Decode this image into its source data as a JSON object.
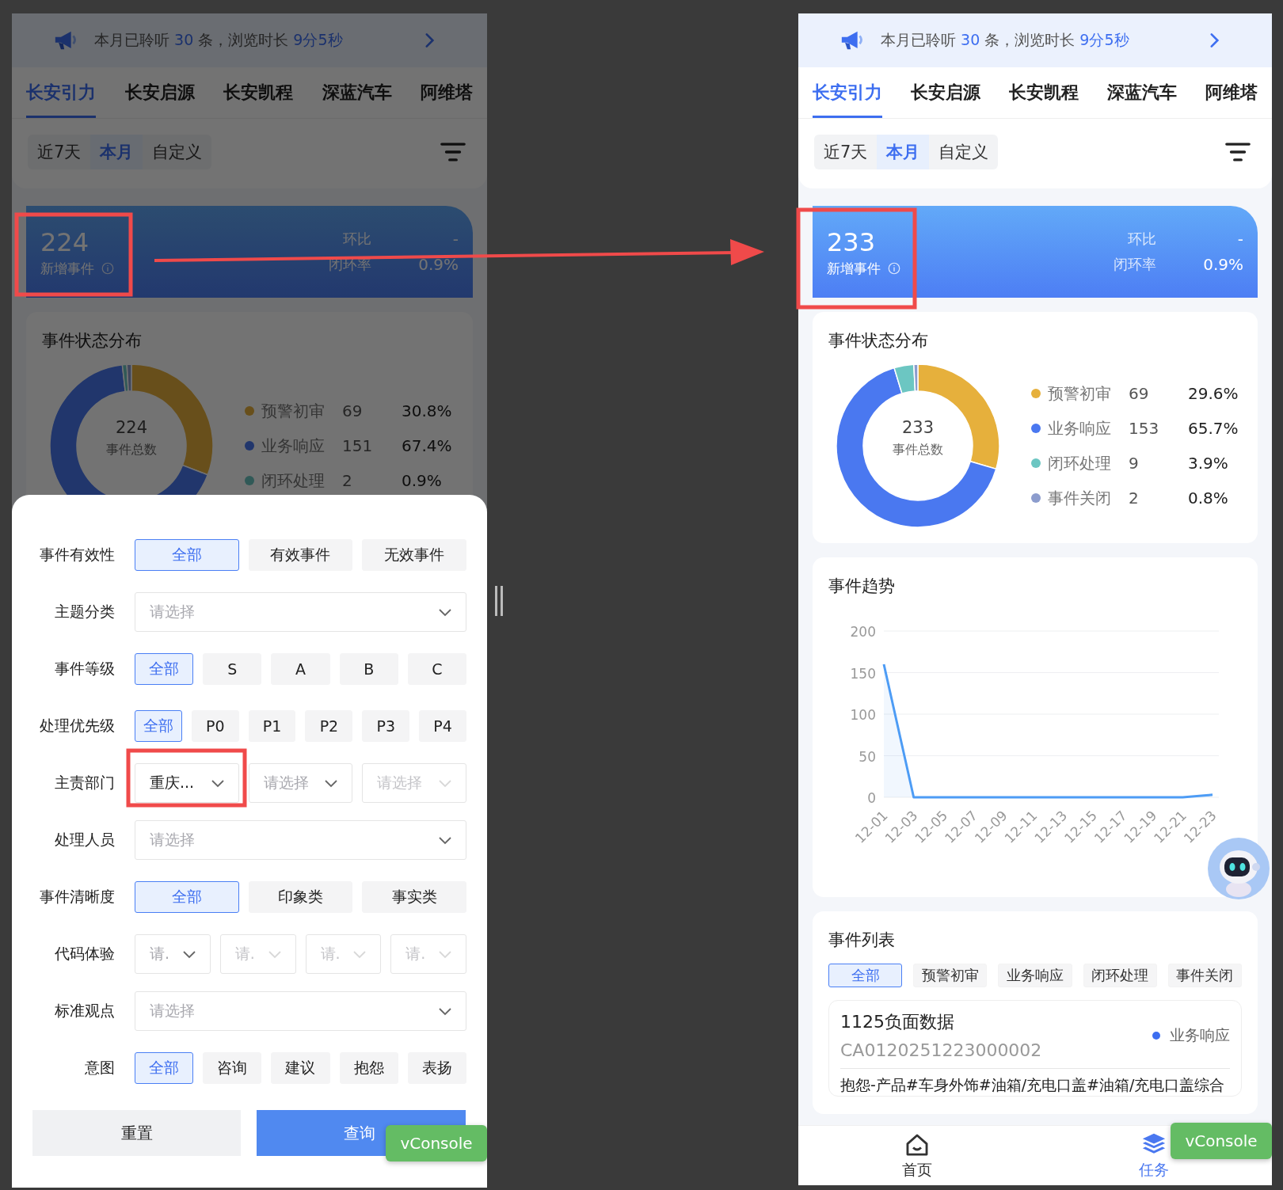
{
  "left_phone": {
    "banner": {
      "segments": [
        {
          "text": "本月已聆听 ",
          "highlight": false
        },
        {
          "text": "30",
          "highlight": true
        },
        {
          "text": " 条，浏览时长 ",
          "highlight": false
        },
        {
          "text": "9分5秒",
          "highlight": true
        }
      ]
    },
    "brand_tabs": [
      {
        "label": "长安引力",
        "selected": true
      },
      {
        "label": "长安启源",
        "selected": false
      },
      {
        "label": "长安凯程",
        "selected": false
      },
      {
        "label": "深蓝汽车",
        "selected": false
      },
      {
        "label": "阿维塔",
        "selected": false
      }
    ],
    "date_tabs": [
      {
        "label": "近7天",
        "selected": false
      },
      {
        "label": "本月",
        "selected": true
      },
      {
        "label": "自定义",
        "selected": false
      }
    ],
    "summary": {
      "count": "224",
      "label": "新增事件",
      "metrics": [
        {
          "label": "环比",
          "value": "-"
        },
        {
          "label": "闭环率",
          "value": "0.9%"
        }
      ]
    },
    "status_distribution": {
      "title": "事件状态分布",
      "total": "224",
      "total_label": "事件总数",
      "chart_data": {
        "type": "donut",
        "values": [
          30.8,
          67.4,
          0.9,
          0.9
        ]
      },
      "legend": [
        {
          "name": "预警初审",
          "count": "69",
          "percent": "30.8%"
        },
        {
          "name": "业务响应",
          "count": "151",
          "percent": "67.4%"
        },
        {
          "name": "闭环处理",
          "count": "2",
          "percent": "0.9%"
        }
      ]
    },
    "filter_sheet": {
      "rows": [
        {
          "label": "事件有效性",
          "kind": "options",
          "options": [
            {
              "label": "全部",
              "selected": true
            },
            {
              "label": "有效事件",
              "selected": false
            },
            {
              "label": "无效事件",
              "selected": false
            }
          ]
        },
        {
          "label": "主题分类",
          "kind": "select",
          "placeholder": "请选择"
        },
        {
          "label": "事件等级",
          "kind": "options",
          "options": [
            {
              "label": "全部",
              "selected": true
            },
            {
              "label": "S",
              "selected": false
            },
            {
              "label": "A",
              "selected": false
            },
            {
              "label": "B",
              "selected": false
            },
            {
              "label": "C",
              "selected": false
            }
          ]
        },
        {
          "label": "处理优先级",
          "kind": "options",
          "options": [
            {
              "label": "全部",
              "selected": true
            },
            {
              "label": "P0",
              "selected": false
            },
            {
              "label": "P1",
              "selected": false
            },
            {
              "label": "P2",
              "selected": false
            },
            {
              "label": "P3",
              "selected": false
            },
            {
              "label": "P4",
              "selected": false
            }
          ]
        },
        {
          "label": "主责部门",
          "kind": "selects",
          "selects": [
            {
              "value": "重庆...",
              "disabled": false
            },
            {
              "placeholder": "请选择",
              "disabled": false
            },
            {
              "placeholder": "请选择",
              "disabled": true
            }
          ]
        },
        {
          "label": "处理人员",
          "kind": "select",
          "placeholder": "请选择"
        },
        {
          "label": "事件清晰度",
          "kind": "options",
          "options": [
            {
              "label": "全部",
              "selected": true
            },
            {
              "label": "印象类",
              "selected": false
            },
            {
              "label": "事实类",
              "selected": false
            }
          ]
        },
        {
          "label": "代码体验",
          "kind": "selects",
          "selects": [
            {
              "placeholder": "请.",
              "disabled": false
            },
            {
              "placeholder": "请.",
              "disabled": true
            },
            {
              "placeholder": "请.",
              "disabled": true
            },
            {
              "placeholder": "请.",
              "disabled": true
            }
          ]
        },
        {
          "label": "标准观点",
          "kind": "select",
          "placeholder": "请选择"
        },
        {
          "label": "意图",
          "kind": "options",
          "options": [
            {
              "label": "全部",
              "selected": true
            },
            {
              "label": "咨询",
              "selected": false
            },
            {
              "label": "建议",
              "selected": false
            },
            {
              "label": "抱怨",
              "selected": false
            },
            {
              "label": "表扬",
              "selected": false
            }
          ]
        }
      ],
      "reset_button": "重置",
      "query_button": "查询"
    },
    "vconsole": "vConsole"
  },
  "right_phone": {
    "banner": {
      "segments": [
        {
          "text": "本月已聆听 ",
          "highlight": false
        },
        {
          "text": "30",
          "highlight": true
        },
        {
          "text": " 条，浏览时长 ",
          "highlight": false
        },
        {
          "text": "9分5秒",
          "highlight": true
        }
      ]
    },
    "brand_tabs": [
      {
        "label": "长安引力",
        "selected": true
      },
      {
        "label": "长安启源",
        "selected": false
      },
      {
        "label": "长安凯程",
        "selected": false
      },
      {
        "label": "深蓝汽车",
        "selected": false
      },
      {
        "label": "阿维塔",
        "selected": false
      }
    ],
    "date_tabs": [
      {
        "label": "近7天",
        "selected": false
      },
      {
        "label": "本月",
        "selected": true
      },
      {
        "label": "自定义",
        "selected": false
      }
    ],
    "summary": {
      "count": "233",
      "label": "新增事件",
      "metrics": [
        {
          "label": "环比",
          "value": "-"
        },
        {
          "label": "闭环率",
          "value": "0.9%"
        }
      ]
    },
    "status_distribution": {
      "title": "事件状态分布",
      "total": "233",
      "total_label": "事件总数",
      "chart_data": {
        "type": "donut",
        "values": [
          29.6,
          65.7,
          3.9,
          0.8
        ]
      },
      "legend": [
        {
          "name": "预警初审",
          "count": "69",
          "percent": "29.6%",
          "color": "#e6b03c"
        },
        {
          "name": "业务响应",
          "count": "153",
          "percent": "65.7%",
          "color": "#4a78f0"
        },
        {
          "name": "闭环处理",
          "count": "9",
          "percent": "3.9%",
          "color": "#6cc6c2"
        },
        {
          "name": "事件关闭",
          "count": "2",
          "percent": "0.8%",
          "color": "#8c9ccd"
        }
      ]
    },
    "trend": {
      "title": "事件趋势",
      "chart_data": {
        "type": "line",
        "x": [
          "12-01",
          "12-03",
          "12-05",
          "12-07",
          "12-09",
          "12-11",
          "12-13",
          "12-15",
          "12-17",
          "12-19",
          "12-21",
          "12-23"
        ],
        "series": [
          {
            "color": "#4d9cf5",
            "values": [
              160,
              0,
              0,
              0,
              0,
              0,
              0,
              0,
              0,
              0,
              0,
              3
            ]
          }
        ],
        "ylim": [
          0,
          200
        ],
        "yticks": [
          0,
          50,
          100,
          150,
          200
        ],
        "grid": true
      }
    },
    "event_list": {
      "title": "事件列表",
      "filters": [
        {
          "label": "全部",
          "selected": true
        },
        {
          "label": "预警初审",
          "selected": false
        },
        {
          "label": "业务响应",
          "selected": false
        },
        {
          "label": "闭环处理",
          "selected": false
        },
        {
          "label": "事件关闭",
          "selected": false
        }
      ],
      "items": [
        {
          "title": "1125负面数据",
          "code": "CA0120251223000002",
          "status": "业务响应",
          "color": "#3d6ef0",
          "description": "抱怨-产品#车身外饰#油箱/充电口盖#油箱/充电口盖综合"
        }
      ]
    },
    "bottom_nav": [
      {
        "label": "首页",
        "kind": "home",
        "selected": false
      },
      {
        "label": "任务",
        "kind": "tasks",
        "selected": true
      }
    ],
    "vconsole": "vConsole"
  }
}
